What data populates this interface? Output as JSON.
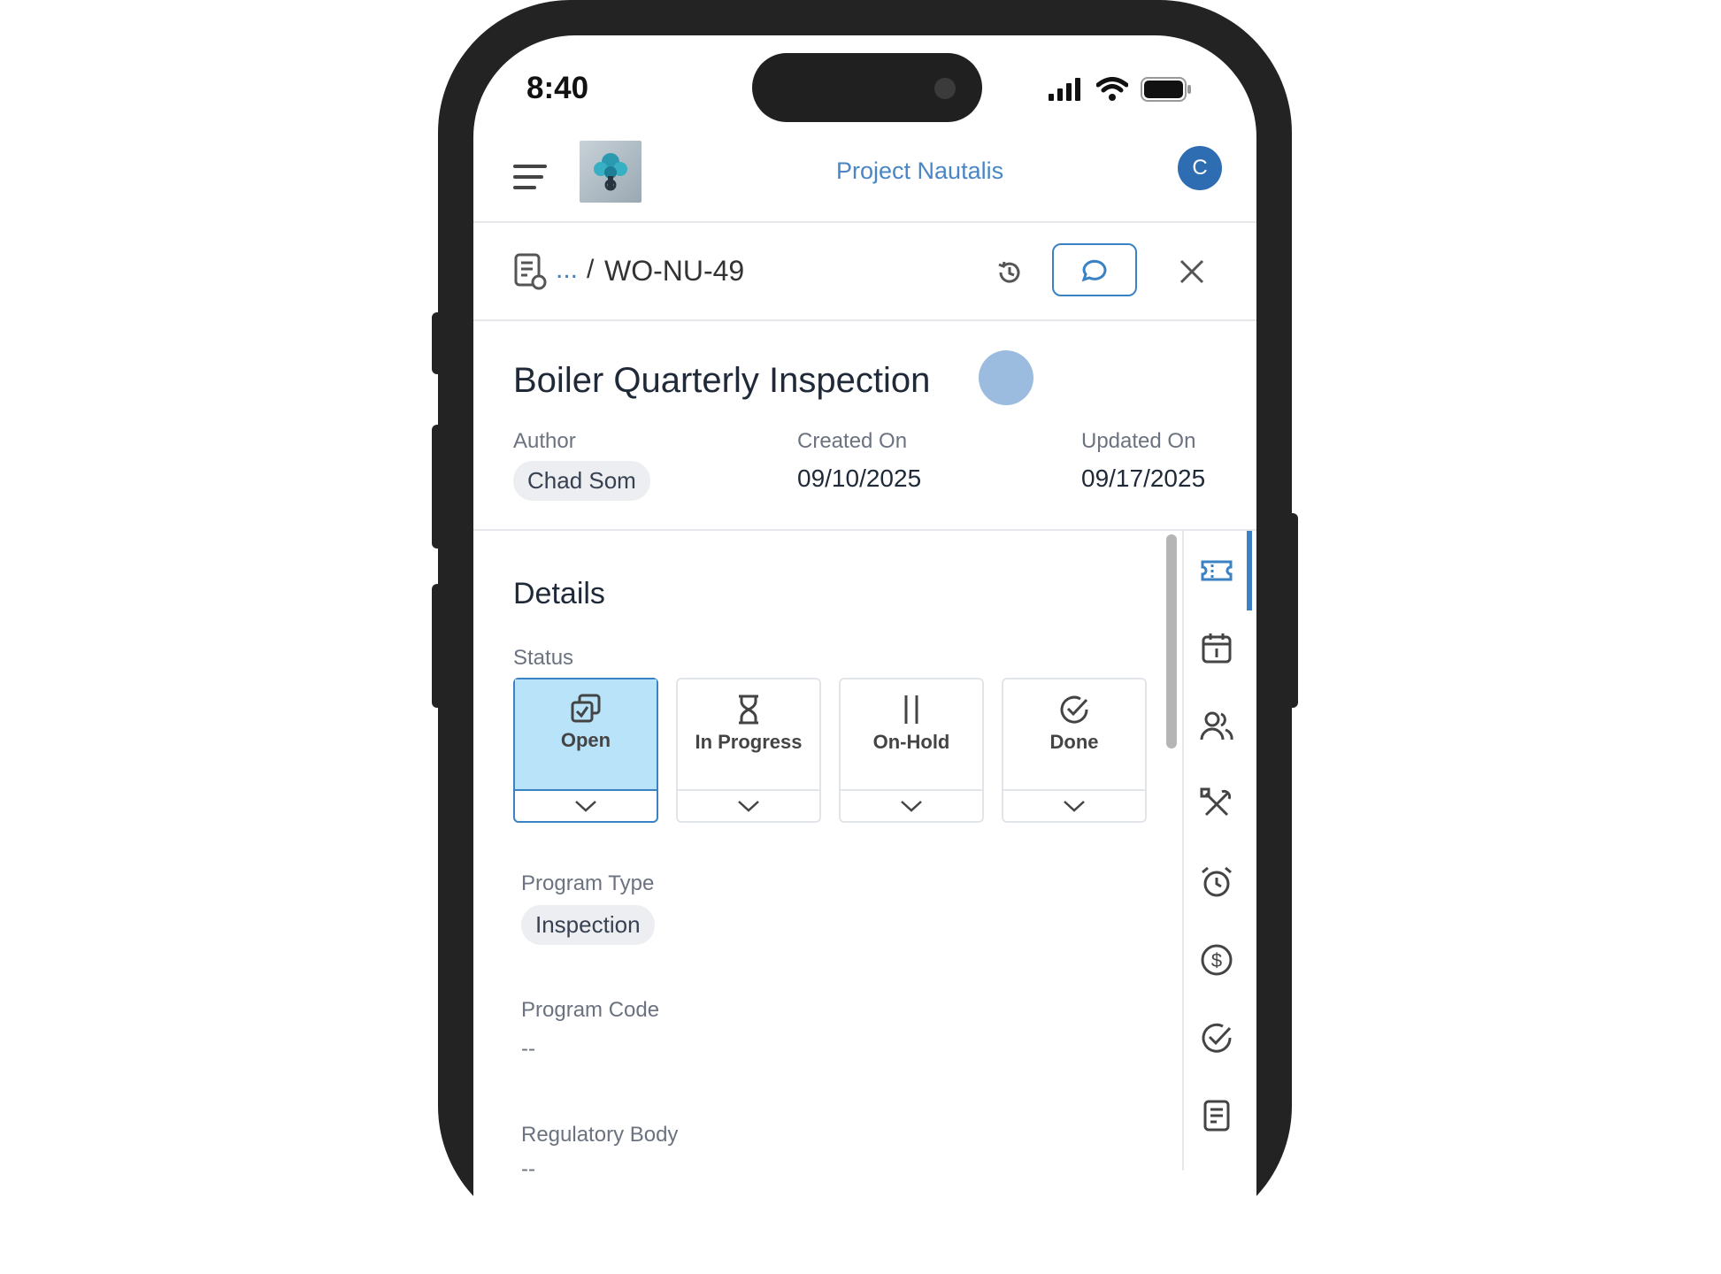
{
  "status_bar": {
    "time": "8:40"
  },
  "header": {
    "app_title": "Project Nautalis",
    "avatar_initial": "C"
  },
  "breadcrumb": {
    "ellipsis": "...",
    "separator": "/",
    "current": "WO-NU-49"
  },
  "work_order": {
    "title": "Boiler Quarterly Inspection",
    "author_label": "Author",
    "author": "Chad Som",
    "created_label": "Created On",
    "created": "09/10/2025",
    "updated_label": "Updated On",
    "updated": "09/17/2025"
  },
  "details": {
    "title": "Details",
    "status_label": "Status",
    "statuses": [
      {
        "label": "Open",
        "icon": "open-icon",
        "active": true
      },
      {
        "label": "In Progress",
        "icon": "hourglass-icon",
        "active": false
      },
      {
        "label": "On-Hold",
        "icon": "pause-icon",
        "active": false
      },
      {
        "label": "Done",
        "icon": "check-circle-icon",
        "active": false
      }
    ],
    "program_type_label": "Program Type",
    "program_type": "Inspection",
    "program_code_label": "Program Code",
    "program_code": "--",
    "regulatory_body_label": "Regulatory Body",
    "regulatory_body": "--"
  },
  "side_rail": [
    "ticket-icon",
    "calendar-icon",
    "users-icon",
    "tools-icon",
    "alarm-icon",
    "dollar-icon",
    "check-circle-icon",
    "document-icon"
  ],
  "colors": {
    "accent": "#3b82c4",
    "active_status_bg": "#b9e3f8",
    "title_blue": "#4a86c5",
    "avatar": "#2f6db3"
  }
}
